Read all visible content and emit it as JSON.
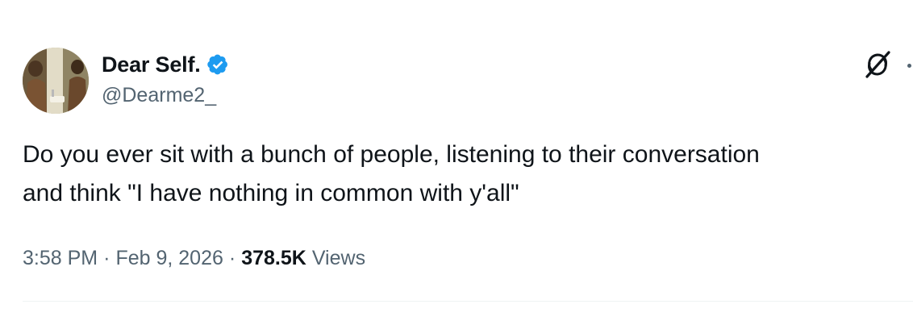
{
  "tweet": {
    "author": {
      "display_name": "Dear Self.",
      "handle": "@Dearme2_",
      "verified": true,
      "verified_icon": "verified-badge-icon",
      "avatar_icon": "avatar-photo"
    },
    "text": "Do you ever sit with a bunch of people, listening to their conversation\nand think \"I have nothing in common with y'all\"",
    "meta": {
      "time": "3:58 PM",
      "separator": "·",
      "date": "Feb 9, 2026",
      "views_count": "378.5K",
      "views_label": "Views"
    },
    "actions": {
      "grok_icon": "grok-icon",
      "more_icon": "more-icon"
    },
    "colors": {
      "text_primary": "#0f1419",
      "text_secondary": "#536471",
      "verified_blue": "#1d9bf0",
      "divider": "#eff3f4"
    }
  }
}
